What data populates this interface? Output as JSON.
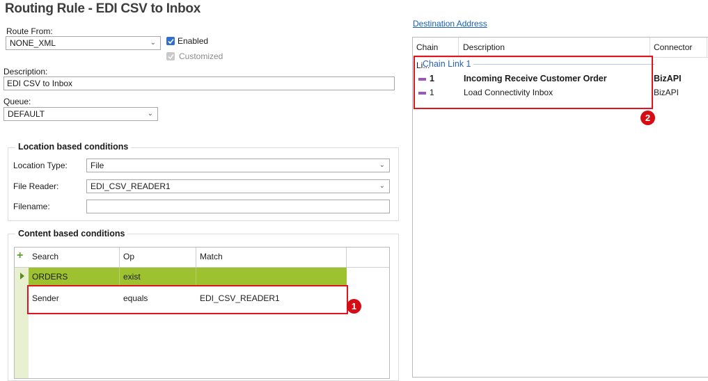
{
  "title": "Routing Rule - EDI CSV to Inbox",
  "route_from": {
    "label": "Route From:",
    "value": "NONE_XML"
  },
  "enabled": {
    "label": "Enabled",
    "checked": true
  },
  "customized": {
    "label": "Customized",
    "checked": true,
    "disabled": true
  },
  "description": {
    "label": "Description:",
    "value": "EDI CSV to Inbox"
  },
  "queue": {
    "label": "Queue:",
    "value": "DEFAULT"
  },
  "location_conditions": {
    "title": "Location based conditions",
    "location_type": {
      "label": "Location Type:",
      "value": "File"
    },
    "file_reader": {
      "label": "File Reader:",
      "value": "EDI_CSV_READER1"
    },
    "filename": {
      "label": "Filename:",
      "value": ""
    }
  },
  "content_conditions": {
    "title": "Content based conditions",
    "columns": [
      "Search",
      "Op",
      "Match"
    ],
    "rows": [
      {
        "search": "ORDERS",
        "op": "exist",
        "match": ""
      },
      {
        "search": "Sender",
        "op": "equals",
        "match": "EDI_CSV_READER1"
      }
    ]
  },
  "destination": {
    "link_label": "Destination Address",
    "columns": [
      "Chain Li...",
      "Description",
      "Connector"
    ],
    "group": "Chain Link 1",
    "rows": [
      {
        "num": "1",
        "description": "Incoming Receive Customer Order",
        "connector": "BizAPI",
        "bold": true
      },
      {
        "num": "1",
        "description": "Load Connectivity Inbox",
        "connector": "BizAPI",
        "bold": false
      }
    ]
  },
  "annotations": {
    "badge1": "1",
    "badge2": "2"
  },
  "colors": {
    "accent_check": "#2f6fd1",
    "row_highlight": "#9ec22f",
    "annotation_red": "#e0141e",
    "link": "#1a5fb4",
    "chain_bar": "#9b59b6"
  }
}
